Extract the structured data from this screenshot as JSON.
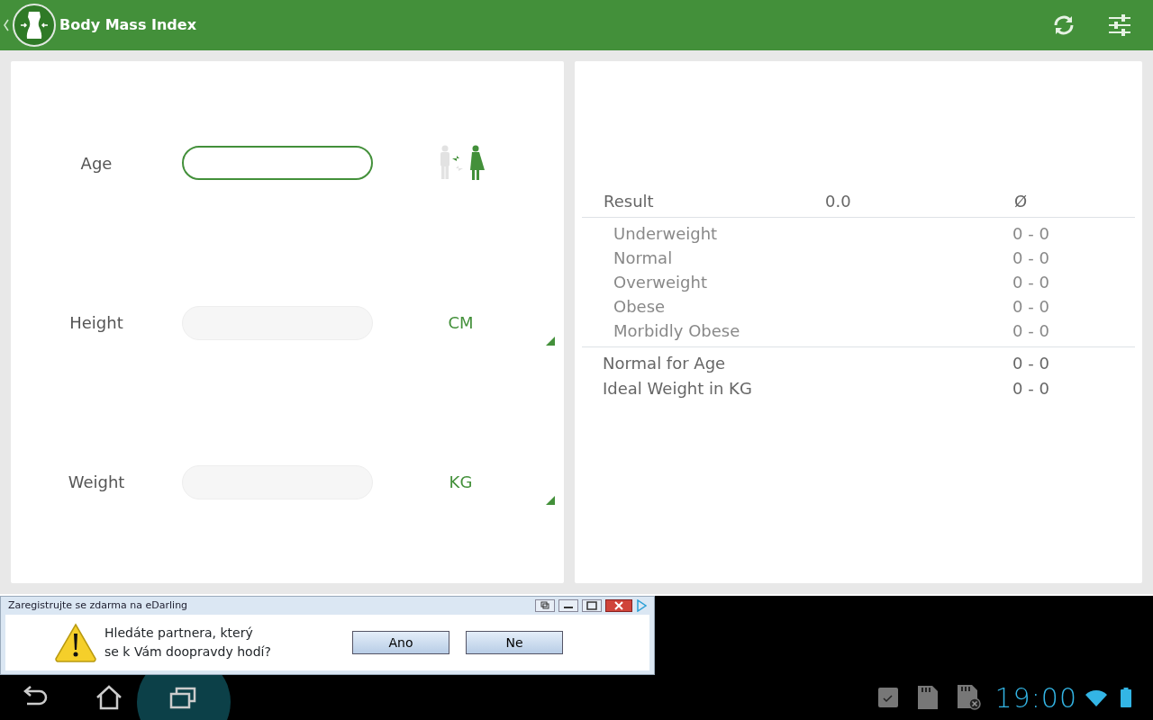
{
  "app_bar": {
    "title": "Body Mass Index"
  },
  "inputs": [
    {
      "label": "Age",
      "focused": true
    },
    {
      "label": "Height",
      "focused": false,
      "unit": "CM"
    },
    {
      "label": "Weight",
      "focused": false,
      "unit": "KG"
    }
  ],
  "result": {
    "label": "Result",
    "value": "0.0",
    "symbol": "Ø"
  },
  "categories": [
    {
      "label": "Underweight",
      "range": "0 - 0"
    },
    {
      "label": "Normal",
      "range": "0 - 0"
    },
    {
      "label": "Overweight",
      "range": "0 - 0"
    },
    {
      "label": "Obese",
      "range": "0 - 0"
    },
    {
      "label": "Morbidly Obese",
      "range": "0 - 0"
    }
  ],
  "summary": [
    {
      "label": "Normal for Age",
      "range": "0 - 0"
    },
    {
      "label": "Ideal Weight in KG",
      "range": "0 - 0"
    }
  ],
  "ad": {
    "title": "Zaregistrujte se zdarma na eDarling",
    "message": "Hledáte partnera, který\nse k Vám doopravdy hodí?",
    "buttons": [
      "Ano",
      "Ne"
    ]
  },
  "status_bar": {
    "time": "19:00"
  }
}
